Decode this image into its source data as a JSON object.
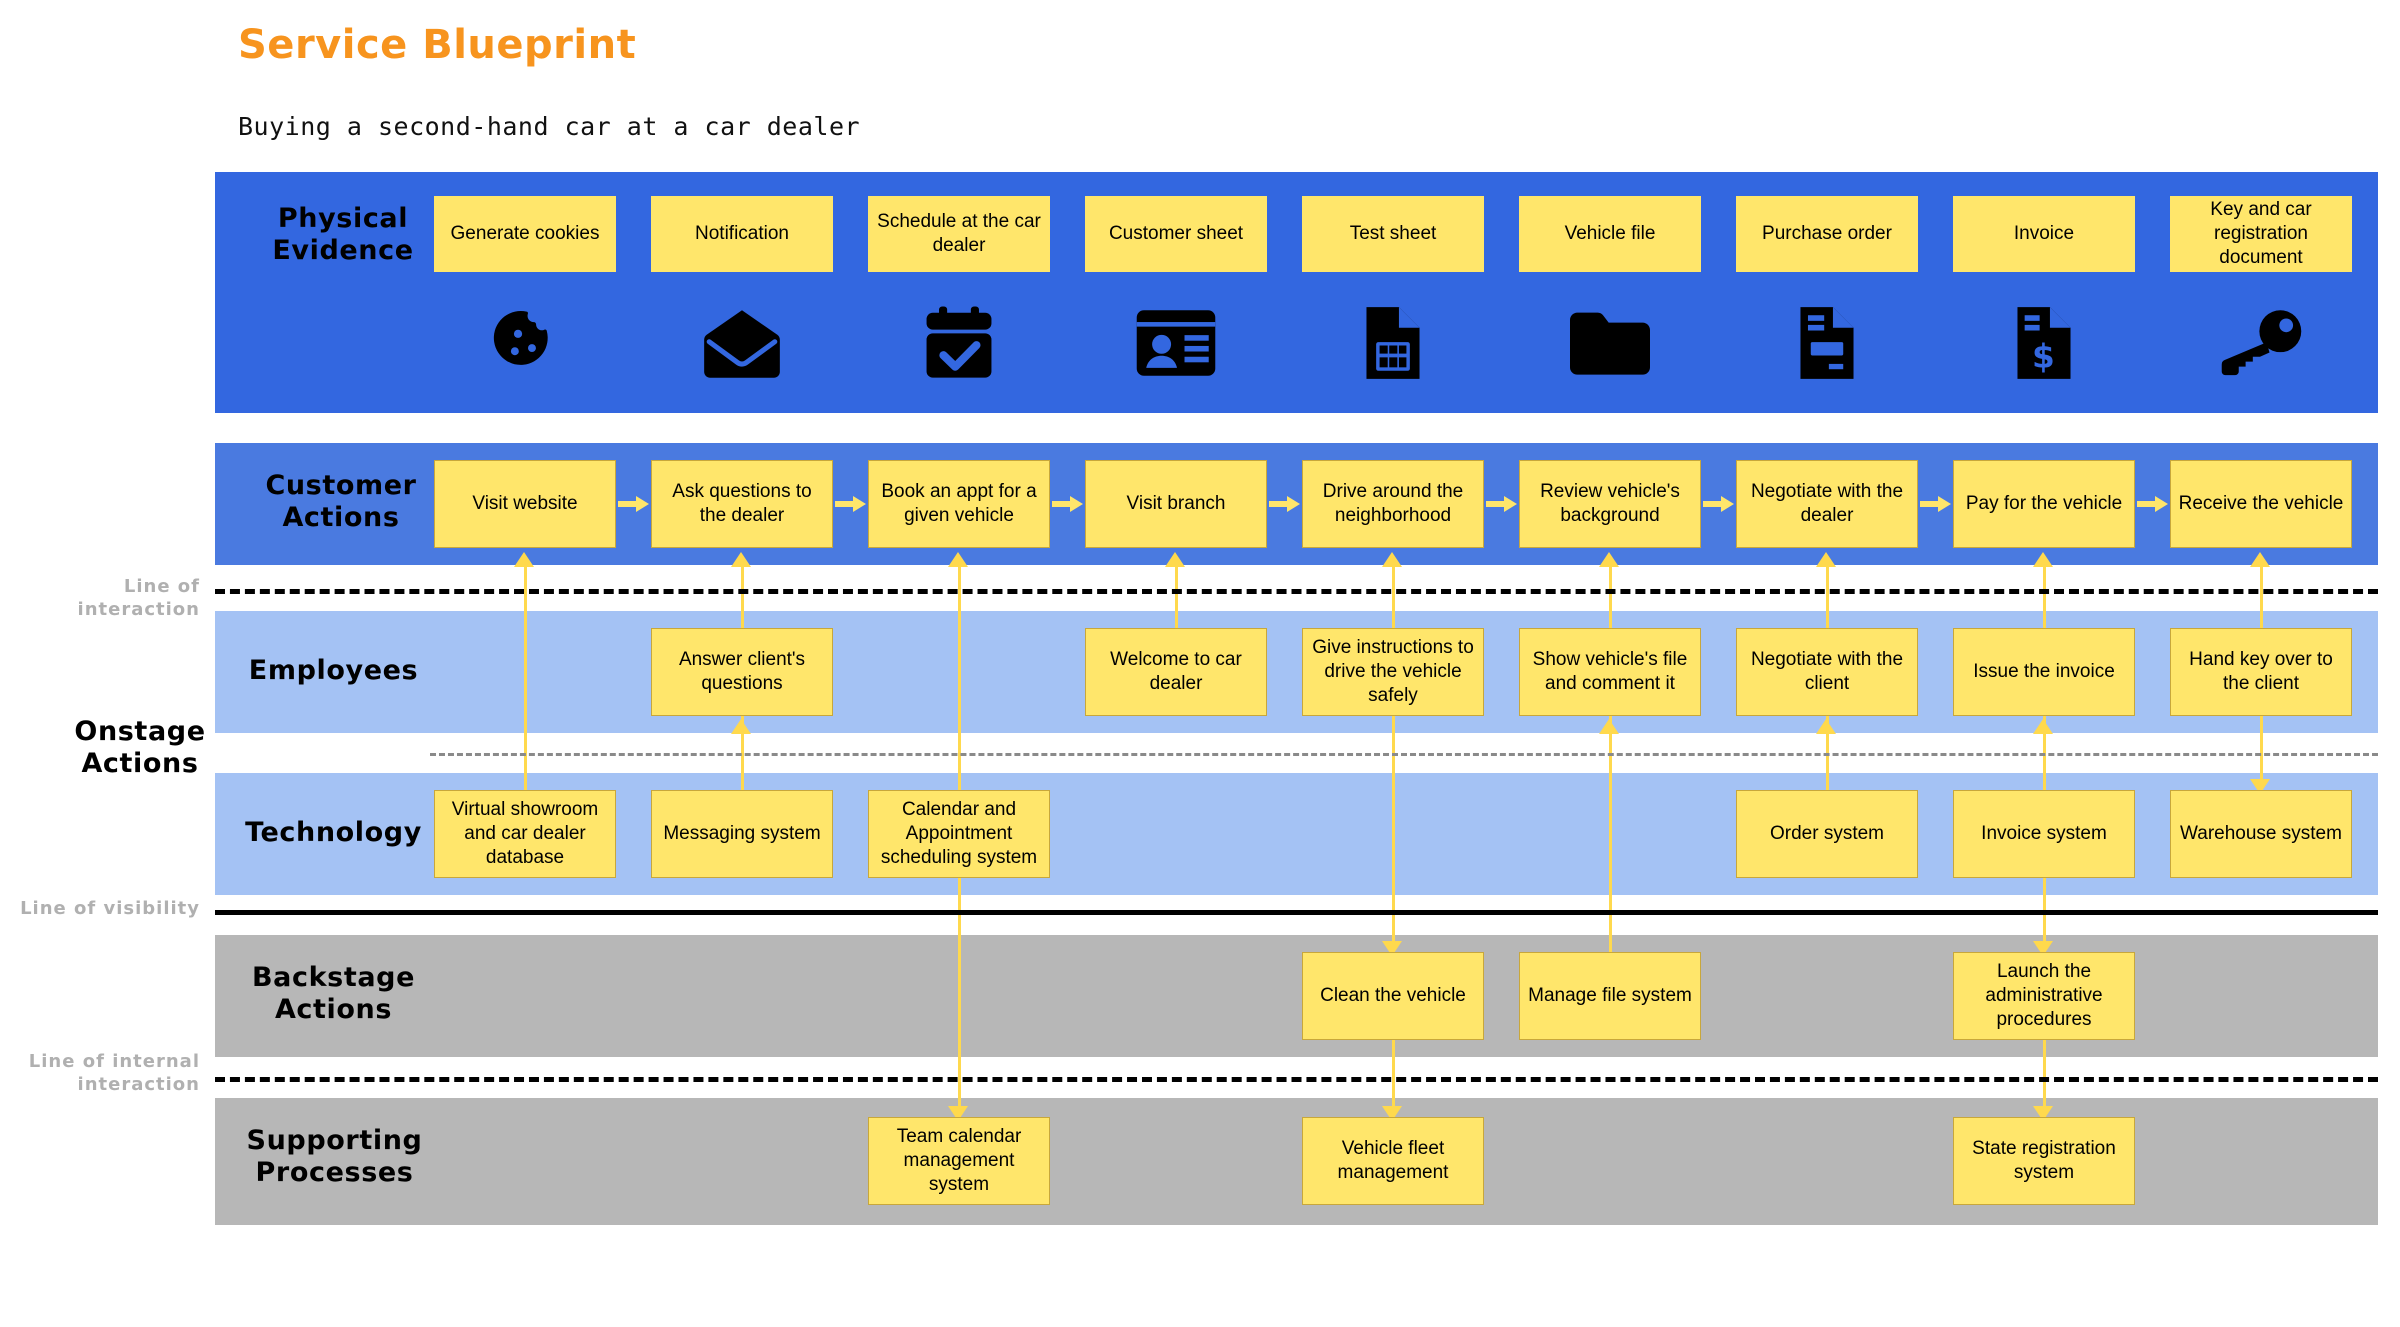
{
  "header": {
    "title": "Service Blueprint",
    "subtitle": "Buying a second-hand car at a car dealer",
    "title_color": "#f7941e"
  },
  "colors": {
    "physical_band": "#3367e0",
    "customer_band": "#4a7ae0",
    "light_blue_band": "#a4c2f4",
    "grey_band": "#b7b7b7",
    "box_fill": "#ffe66b",
    "connector": "#ffd94d"
  },
  "bands": {
    "physical_evidence": {
      "label": "Physical\nEvidence",
      "label_line1": "Physical",
      "label_line2": "Evidence"
    },
    "customer_actions": {
      "label_line1": "Customer",
      "label_line2": "Actions"
    },
    "employees": {
      "label_line1": "Employees",
      "label_line2": ""
    },
    "technology": {
      "label_line1": "Technology",
      "label_line2": ""
    },
    "backstage_actions": {
      "label_line1": "Backstage",
      "label_line2": "Actions"
    },
    "supporting_processes": {
      "label_line1": "Supporting",
      "label_line2": "Processes"
    }
  },
  "group_labels": {
    "onstage_line1": "Onstage",
    "onstage_line2": "Actions"
  },
  "divider_lines": {
    "interaction": "Line of interaction",
    "visibility": "Line of visibility",
    "internal_line1": "Line of internal",
    "internal_line2": "interaction"
  },
  "physical_evidence": {
    "items": [
      {
        "label": "Generate cookies",
        "icon": "cookie-icon"
      },
      {
        "label": "Notification",
        "icon": "envelope-icon"
      },
      {
        "label_line1": "Schedule at the",
        "label_line2": "car dealer",
        "label": "Schedule at the car dealer",
        "icon": "calendar-check-icon"
      },
      {
        "label": "Customer sheet",
        "icon": "id-card-icon"
      },
      {
        "label": "Test sheet",
        "icon": "document-table-icon"
      },
      {
        "label": "Vehicle file",
        "icon": "folder-icon"
      },
      {
        "label": "Purchase order",
        "icon": "document-order-icon"
      },
      {
        "label": "Invoice",
        "icon": "document-dollar-icon"
      },
      {
        "label": "Key and car registration document",
        "icon": "key-icon"
      }
    ]
  },
  "customer_actions": {
    "items": [
      "Visit website",
      "Ask questions to the dealer",
      "Book an appt for a given vehicle",
      "Visit branch",
      "Drive around the neighborhood",
      "Review vehicle's background",
      "Negotiate with the dealer",
      "Pay for the vehicle",
      "Receive the vehicle"
    ]
  },
  "employees": {
    "items": [
      {
        "col": 2,
        "label": "Answer client's questions"
      },
      {
        "col": 4,
        "label": "Welcome to car dealer"
      },
      {
        "col": 5,
        "label": "Give instructions to drive the vehicle safely"
      },
      {
        "col": 6,
        "label": "Show vehicle's file and comment it"
      },
      {
        "col": 7,
        "label": "Negotiate with the client"
      },
      {
        "col": 8,
        "label": "Issue the invoice"
      },
      {
        "col": 9,
        "label": "Hand key over to the client"
      }
    ]
  },
  "technology": {
    "items": [
      {
        "col": 1,
        "label": "Virtual showroom and car dealer database"
      },
      {
        "col": 2,
        "label": "Messaging system"
      },
      {
        "col": 3,
        "label": "Calendar and Appointment scheduling system"
      },
      {
        "col": 7,
        "label": "Order system"
      },
      {
        "col": 8,
        "label": "Invoice system"
      },
      {
        "col": 9,
        "label": "Warehouse system"
      }
    ]
  },
  "backstage_actions": {
    "items": [
      {
        "col": 5,
        "label": "Clean the vehicle"
      },
      {
        "col": 6,
        "label": "Manage file system"
      },
      {
        "col": 8,
        "label": "Launch the administrative procedures"
      }
    ]
  },
  "supporting_processes": {
    "items": [
      {
        "col": 3,
        "label": "Team calendar management system"
      },
      {
        "col": 5,
        "label": "Vehicle fleet management"
      },
      {
        "col": 8,
        "label": "State registration system"
      }
    ]
  }
}
